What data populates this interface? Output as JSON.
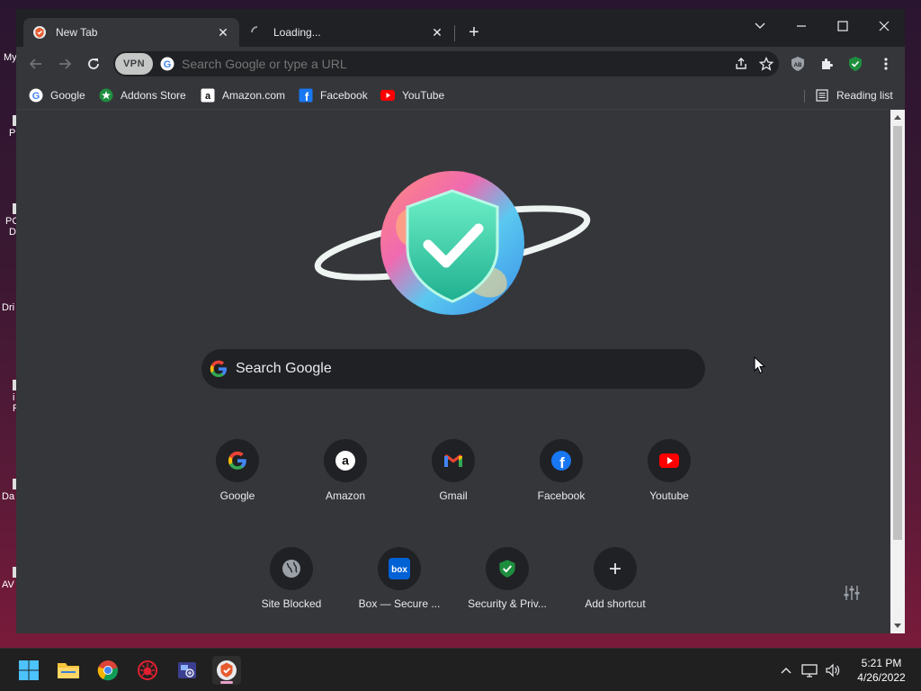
{
  "desktop": {
    "icon_labels": [
      "My",
      "P",
      "PC",
      "D",
      "Dri",
      "i",
      "F",
      "Da",
      "AV"
    ]
  },
  "tabs": [
    {
      "label": "New Tab",
      "active": true
    },
    {
      "label": "Loading...",
      "active": false
    }
  ],
  "omnibox": {
    "vpn_label": "VPN",
    "placeholder": "Search Google or type a URL"
  },
  "bookmarks": [
    {
      "label": "Google",
      "icon": "google-icon"
    },
    {
      "label": "Addons Store",
      "icon": "addons-store-icon"
    },
    {
      "label": "Amazon.com",
      "icon": "amazon-icon"
    },
    {
      "label": "Facebook",
      "icon": "facebook-icon"
    },
    {
      "label": "YouTube",
      "icon": "youtube-icon"
    }
  ],
  "reading_list": {
    "label": "Reading list"
  },
  "ntp": {
    "search_placeholder": "Search Google",
    "shortcuts_row1": [
      {
        "label": "Google",
        "icon": "google-icon"
      },
      {
        "label": "Amazon",
        "icon": "amazon-icon"
      },
      {
        "label": "Gmail",
        "icon": "gmail-icon"
      },
      {
        "label": "Facebook",
        "icon": "facebook-icon"
      },
      {
        "label": "Youtube",
        "icon": "youtube-icon"
      }
    ],
    "shortcuts_row2": [
      {
        "label": "Site Blocked",
        "icon": "globe-icon"
      },
      {
        "label": "Box — Secure ...",
        "icon": "box-icon"
      },
      {
        "label": "Security & Priv...",
        "icon": "shield-check-icon"
      },
      {
        "label": "Add shortcut",
        "icon": "plus-icon"
      }
    ]
  },
  "taskbar": {
    "time": "5:21 PM",
    "date": "4/26/2022"
  },
  "colors": {
    "browser_bg": "#202124",
    "toolbar_bg": "#35363a",
    "text": "#e8eaed",
    "accent_green": "#1e8e3e"
  }
}
